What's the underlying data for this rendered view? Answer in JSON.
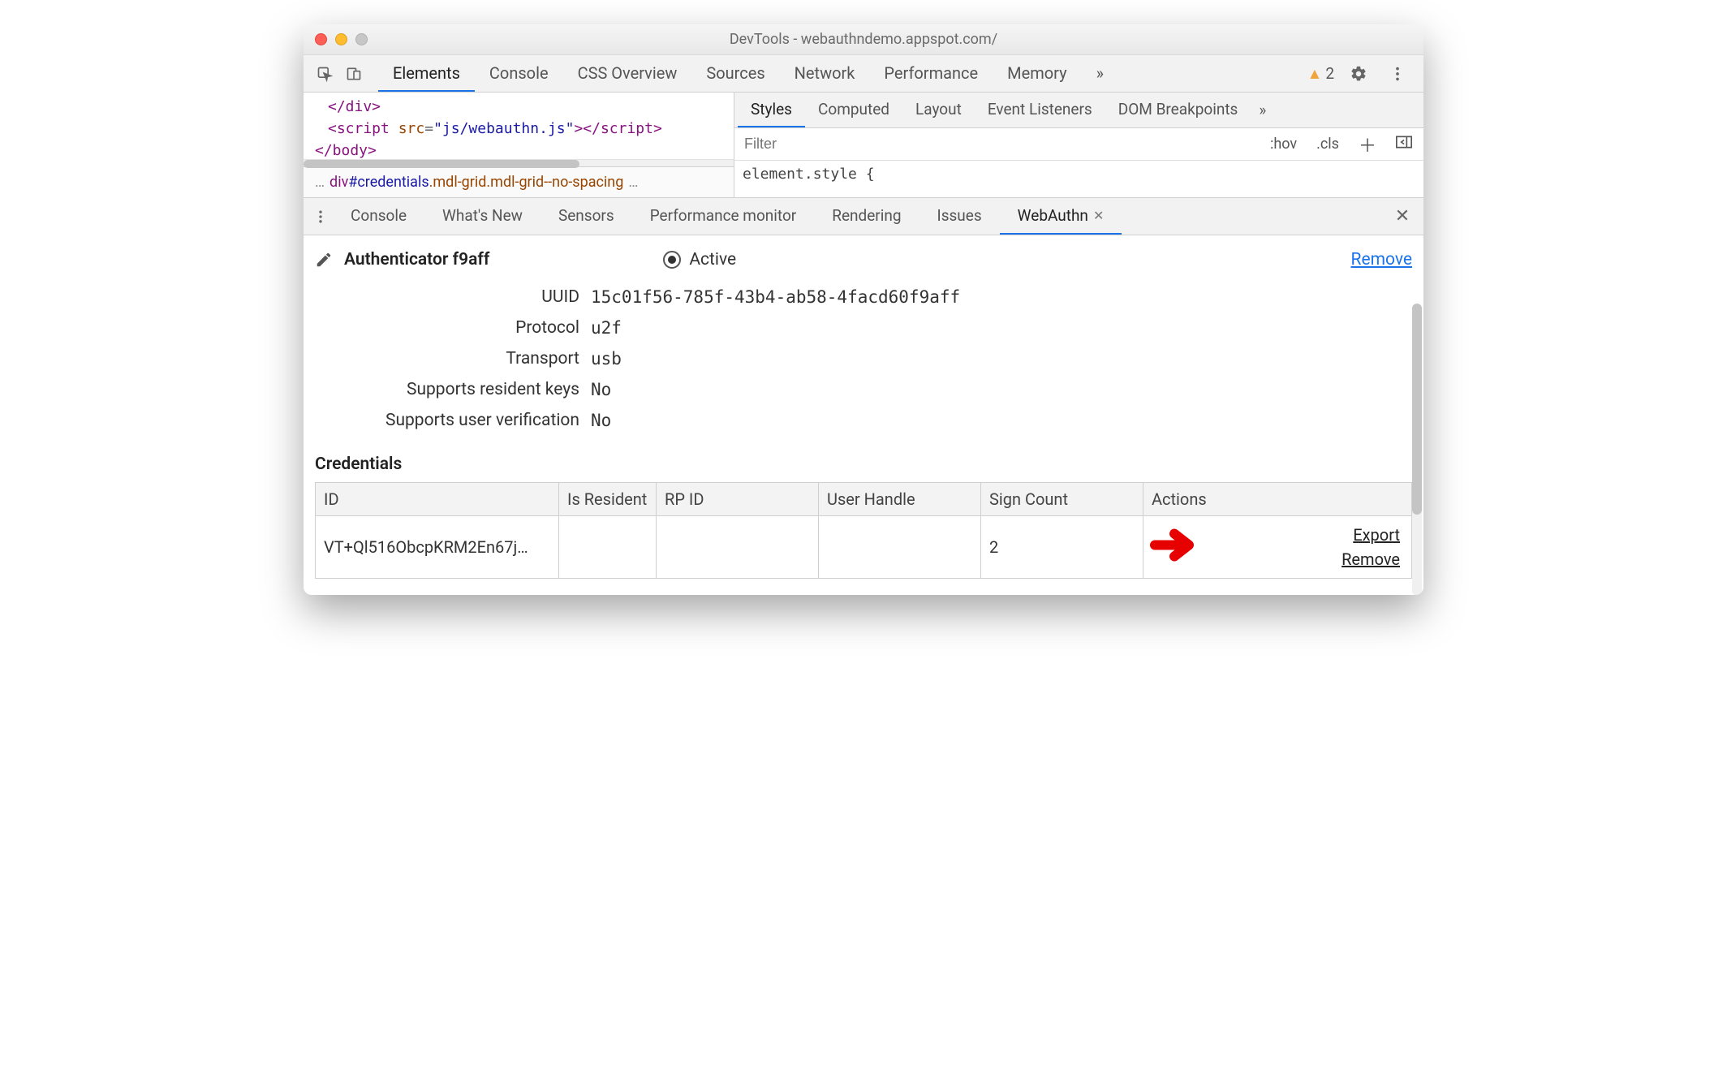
{
  "window": {
    "title": "DevTools - webauthndemo.appspot.com/"
  },
  "tabs": {
    "items": [
      "Elements",
      "Console",
      "CSS Overview",
      "Sources",
      "Network",
      "Performance",
      "Memory"
    ],
    "active": "Elements",
    "warn_count": "2",
    "more": "»"
  },
  "code": {
    "l1_tag": "</div>",
    "l2_open": "<script",
    "l2_attr": "src",
    "l2_val": "\"js/webauthn.js\"",
    "l2_close": "></script>",
    "l3": "</body>"
  },
  "breadcrumb": {
    "leading": "…",
    "element": "div",
    "id": "#credentials",
    "classes": ".mdl-grid.mdl-grid--no-spacing",
    "trailing": "…"
  },
  "styles": {
    "tabs": [
      "Styles",
      "Computed",
      "Layout",
      "Event Listeners",
      "DOM Breakpoints"
    ],
    "active": "Styles",
    "more": "»",
    "filter_placeholder": "Filter",
    "hov": ":hov",
    "cls": ".cls",
    "rule": "element.style {"
  },
  "drawer": {
    "tabs": [
      "Console",
      "What's New",
      "Sensors",
      "Performance monitor",
      "Rendering",
      "Issues",
      "WebAuthn"
    ],
    "active": "WebAuthn"
  },
  "auth": {
    "title": "Authenticator f9aff",
    "active_label": "Active",
    "remove": "Remove",
    "props": [
      {
        "label": "UUID",
        "value": "15c01f56-785f-43b4-ab58-4facd60f9aff"
      },
      {
        "label": "Protocol",
        "value": "u2f"
      },
      {
        "label": "Transport",
        "value": "usb"
      },
      {
        "label": "Supports resident keys",
        "value": "No"
      },
      {
        "label": "Supports user verification",
        "value": "No"
      }
    ]
  },
  "credentials": {
    "heading": "Credentials",
    "headers": [
      "ID",
      "Is Resident",
      "RP ID",
      "User Handle",
      "Sign Count",
      "Actions"
    ],
    "rows": [
      {
        "id": "VT+Ql516ObcpKRM2En67j…",
        "is_resident": "",
        "rp_id": "",
        "user_handle": "",
        "sign_count": "2",
        "actions": {
          "export": "Export",
          "remove": "Remove"
        }
      }
    ]
  }
}
